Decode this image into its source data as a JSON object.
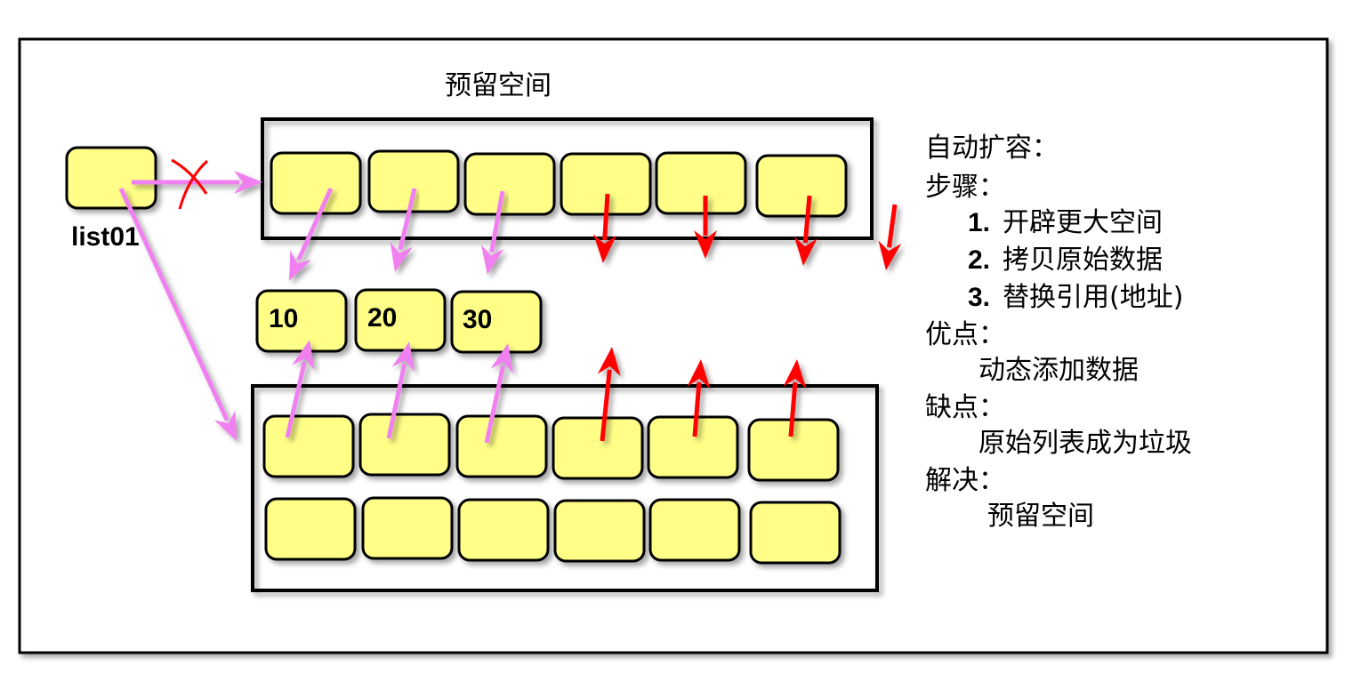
{
  "diagram": {
    "title": "预留空间",
    "list_label": "list01",
    "values": [
      "10",
      "20",
      "30"
    ]
  },
  "notes": {
    "heading": "自动扩容：",
    "steps_heading": "步骤：",
    "steps": [
      {
        "num": "1.",
        "text": "开辟更大空间"
      },
      {
        "num": "2.",
        "text": "拷贝原始数据"
      },
      {
        "num": "3.",
        "text": "替换引用(地址)"
      }
    ],
    "pros_heading": "优点：",
    "pros": "动态添加数据",
    "cons_heading": "缺点：",
    "cons": "原始列表成为垃圾",
    "solution_heading": "解决：",
    "solution": "预留空间"
  },
  "colors": {
    "cell_fill": "#FFFF88",
    "pink_arrow": "#F080F0",
    "red_arrow": "#FF0000"
  }
}
